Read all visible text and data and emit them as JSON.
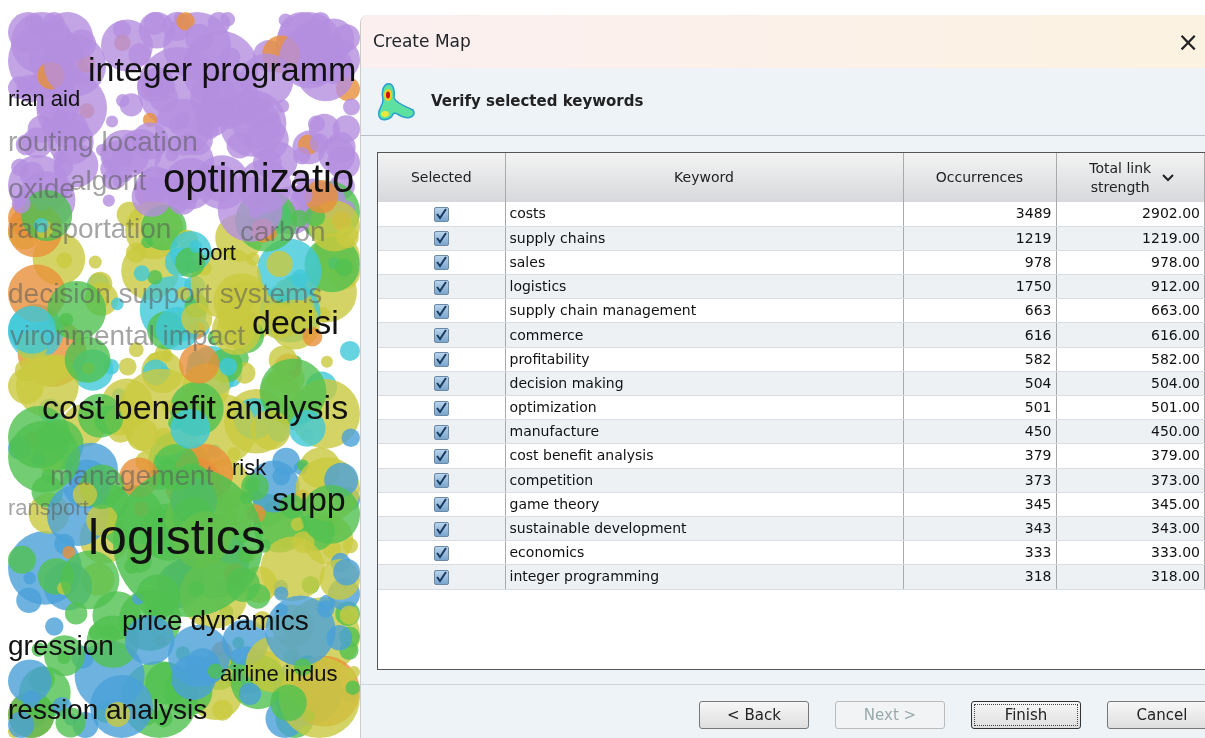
{
  "map": {
    "labels": [
      {
        "text": "integer programm",
        "kind": "dark"
      },
      {
        "text": "rian aid",
        "kind": "dark"
      },
      {
        "text": "routing location",
        "kind": "faint"
      },
      {
        "text": "oxide",
        "kind": "faint"
      },
      {
        "text": "algorit",
        "kind": "faint"
      },
      {
        "text": "optimizatio",
        "kind": "dark"
      },
      {
        "text": "ransportation",
        "kind": "faint"
      },
      {
        "text": "carbon",
        "kind": "faint"
      },
      {
        "text": "port",
        "kind": "dark"
      },
      {
        "text": "decision support systems",
        "kind": "faint"
      },
      {
        "text": "vironmental impact",
        "kind": "faint"
      },
      {
        "text": "decisi",
        "kind": "dark"
      },
      {
        "text": "cost benefit analysis",
        "kind": "dark"
      },
      {
        "text": "risk",
        "kind": "dark"
      },
      {
        "text": "management",
        "kind": "faint"
      },
      {
        "text": "supp",
        "kind": "dark"
      },
      {
        "text": "ransport",
        "kind": "faint"
      },
      {
        "text": "logistics",
        "kind": "dark"
      },
      {
        "text": "price dynamics",
        "kind": "dark"
      },
      {
        "text": "gression",
        "kind": "dark"
      },
      {
        "text": "airline indus",
        "kind": "dark"
      },
      {
        "text": "ression analysis",
        "kind": "dark"
      }
    ]
  },
  "dialog": {
    "title": "Create Map",
    "close": "×",
    "heading": "Verify selected keywords",
    "table": {
      "columns": [
        "Selected",
        "Keyword",
        "Occurrences",
        "Total link strength"
      ],
      "rows": [
        {
          "selected": true,
          "keyword": "costs",
          "occurrences": "3489",
          "strength": "2902.00"
        },
        {
          "selected": true,
          "keyword": "supply chains",
          "occurrences": "1219",
          "strength": "1219.00"
        },
        {
          "selected": true,
          "keyword": "sales",
          "occurrences": "978",
          "strength": "978.00"
        },
        {
          "selected": true,
          "keyword": "logistics",
          "occurrences": "1750",
          "strength": "912.00"
        },
        {
          "selected": true,
          "keyword": "supply chain management",
          "occurrences": "663",
          "strength": "663.00"
        },
        {
          "selected": true,
          "keyword": "commerce",
          "occurrences": "616",
          "strength": "616.00"
        },
        {
          "selected": true,
          "keyword": "profitability",
          "occurrences": "582",
          "strength": "582.00"
        },
        {
          "selected": true,
          "keyword": "decision making",
          "occurrences": "504",
          "strength": "504.00"
        },
        {
          "selected": true,
          "keyword": "optimization",
          "occurrences": "501",
          "strength": "501.00"
        },
        {
          "selected": true,
          "keyword": "manufacture",
          "occurrences": "450",
          "strength": "450.00"
        },
        {
          "selected": true,
          "keyword": "cost benefit analysis",
          "occurrences": "379",
          "strength": "379.00"
        },
        {
          "selected": true,
          "keyword": "competition",
          "occurrences": "373",
          "strength": "373.00"
        },
        {
          "selected": true,
          "keyword": "game theory",
          "occurrences": "345",
          "strength": "345.00"
        },
        {
          "selected": true,
          "keyword": "sustainable development",
          "occurrences": "343",
          "strength": "343.00"
        },
        {
          "selected": true,
          "keyword": "economics",
          "occurrences": "333",
          "strength": "333.00"
        },
        {
          "selected": true,
          "keyword": "integer programming",
          "occurrences": "318",
          "strength": "318.00"
        }
      ]
    },
    "buttons": [
      {
        "label": "< Back",
        "disabled": false,
        "default": false
      },
      {
        "label": "Next >",
        "disabled": true,
        "default": false
      },
      {
        "label": "Finish",
        "disabled": false,
        "default": true
      },
      {
        "label": "Cancel",
        "disabled": false,
        "default": false
      }
    ]
  }
}
